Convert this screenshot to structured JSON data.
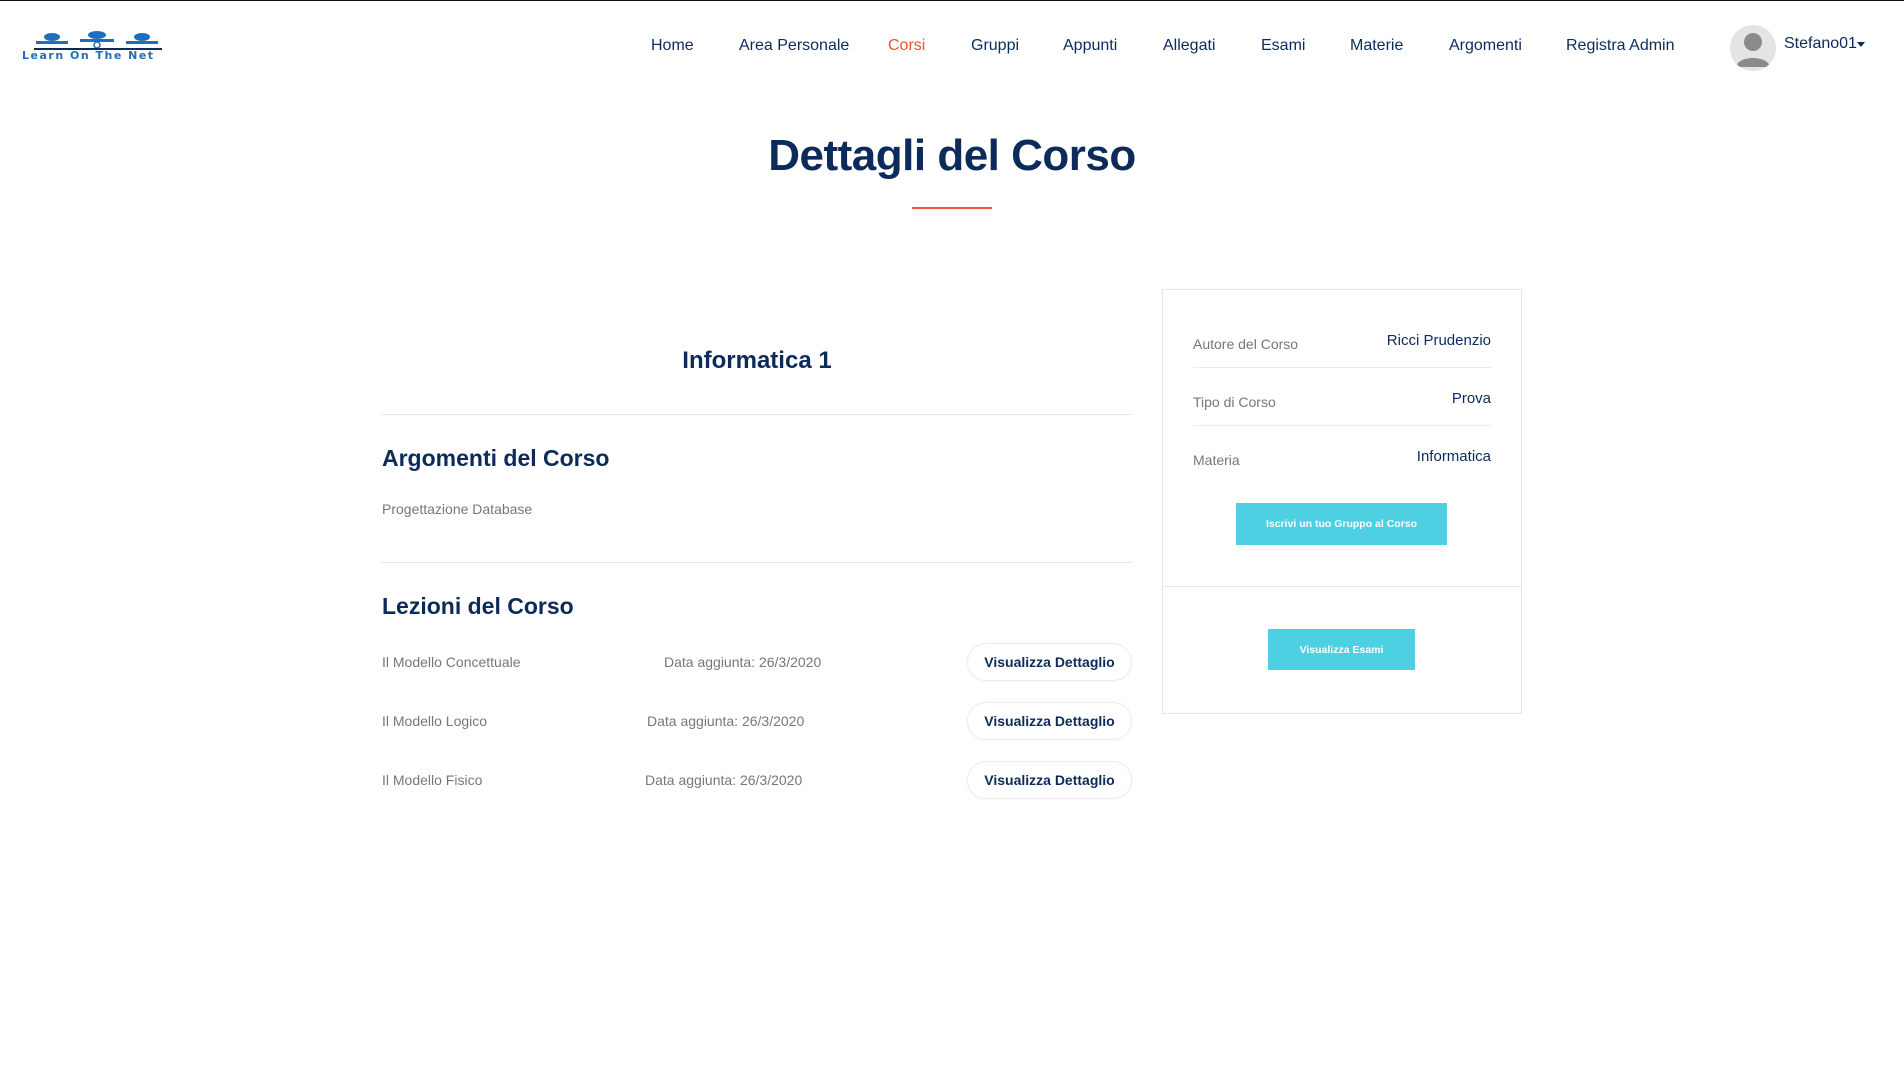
{
  "logo": {
    "text": "Learn On The Net"
  },
  "nav": {
    "items": [
      {
        "label": "Home",
        "active": false
      },
      {
        "label": "Area Personale",
        "active": false
      },
      {
        "label": "Corsi",
        "active": true
      },
      {
        "label": "Gruppi",
        "active": false
      },
      {
        "label": "Appunti",
        "active": false
      },
      {
        "label": "Allegati",
        "active": false
      },
      {
        "label": "Esami",
        "active": false
      },
      {
        "label": "Materie",
        "active": false
      },
      {
        "label": "Argomenti",
        "active": false
      },
      {
        "label": "Registra Admin",
        "active": false
      }
    ],
    "user": {
      "name": "Stefano01",
      "avatar_icon": "user-avatar-icon"
    }
  },
  "page": {
    "title": "Dettagli del Corso"
  },
  "course": {
    "name": "Informatica 1",
    "topics_heading": "Argomenti del Corso",
    "topics": [
      "Progettazione Database"
    ],
    "lessons_heading": "Lezioni del Corso",
    "lessons": [
      {
        "name": "Il Modello Concettuale",
        "date": "Data aggiunta: 26/3/2020",
        "button": "Visualizza Dettaglio"
      },
      {
        "name": "Il Modello Logico",
        "date": "Data aggiunta: 26/3/2020",
        "button": "Visualizza Dettaglio"
      },
      {
        "name": "Il Modello Fisico",
        "date": "Data aggiunta: 26/3/2020",
        "button": "Visualizza Dettaglio"
      }
    ]
  },
  "sidebar": {
    "info": [
      {
        "label": "Autore del Corso",
        "value": "Ricci Prudenzio"
      },
      {
        "label": "Tipo di Corso",
        "value": "Prova"
      },
      {
        "label": "Materia",
        "value": "Informatica"
      }
    ],
    "enroll_button": "Iscrivi un tuo Gruppo al Corso",
    "exams_button": "Visualizza Esami"
  },
  "colors": {
    "primary": "#0c2b5b",
    "accent": "#f0532f",
    "cyan": "#4dd0e1"
  }
}
